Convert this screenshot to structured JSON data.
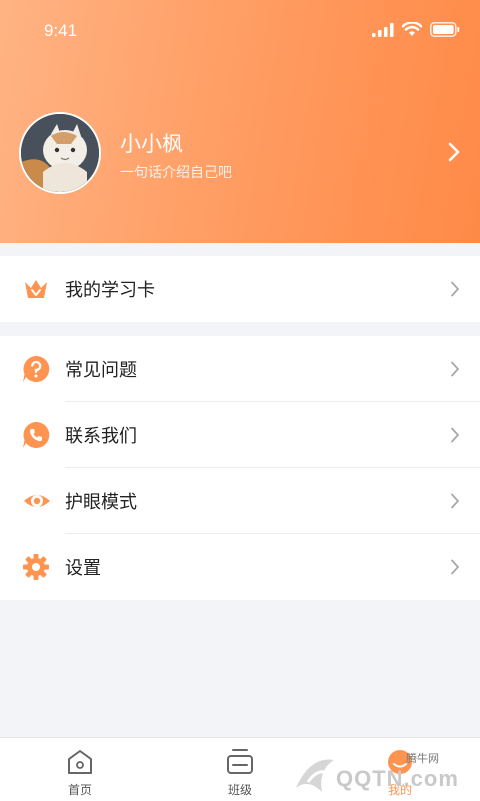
{
  "status_bar": {
    "time": "9:41"
  },
  "profile": {
    "name": "小小枫",
    "bio": "一句话介绍自己吧"
  },
  "menu": {
    "study_card": "我的学习卡",
    "faq": "常见问题",
    "contact": "联系我们",
    "eye_care": "护眼模式",
    "settings": "设置"
  },
  "tabbar": {
    "home": "首页",
    "class": "班级",
    "me": "我的"
  },
  "watermark": {
    "site": "腾牛网",
    "brand": "QQTN.com"
  },
  "colors": {
    "accent": "#ff9450",
    "header_start": "#ffb383",
    "header_end": "#ff8a47"
  }
}
